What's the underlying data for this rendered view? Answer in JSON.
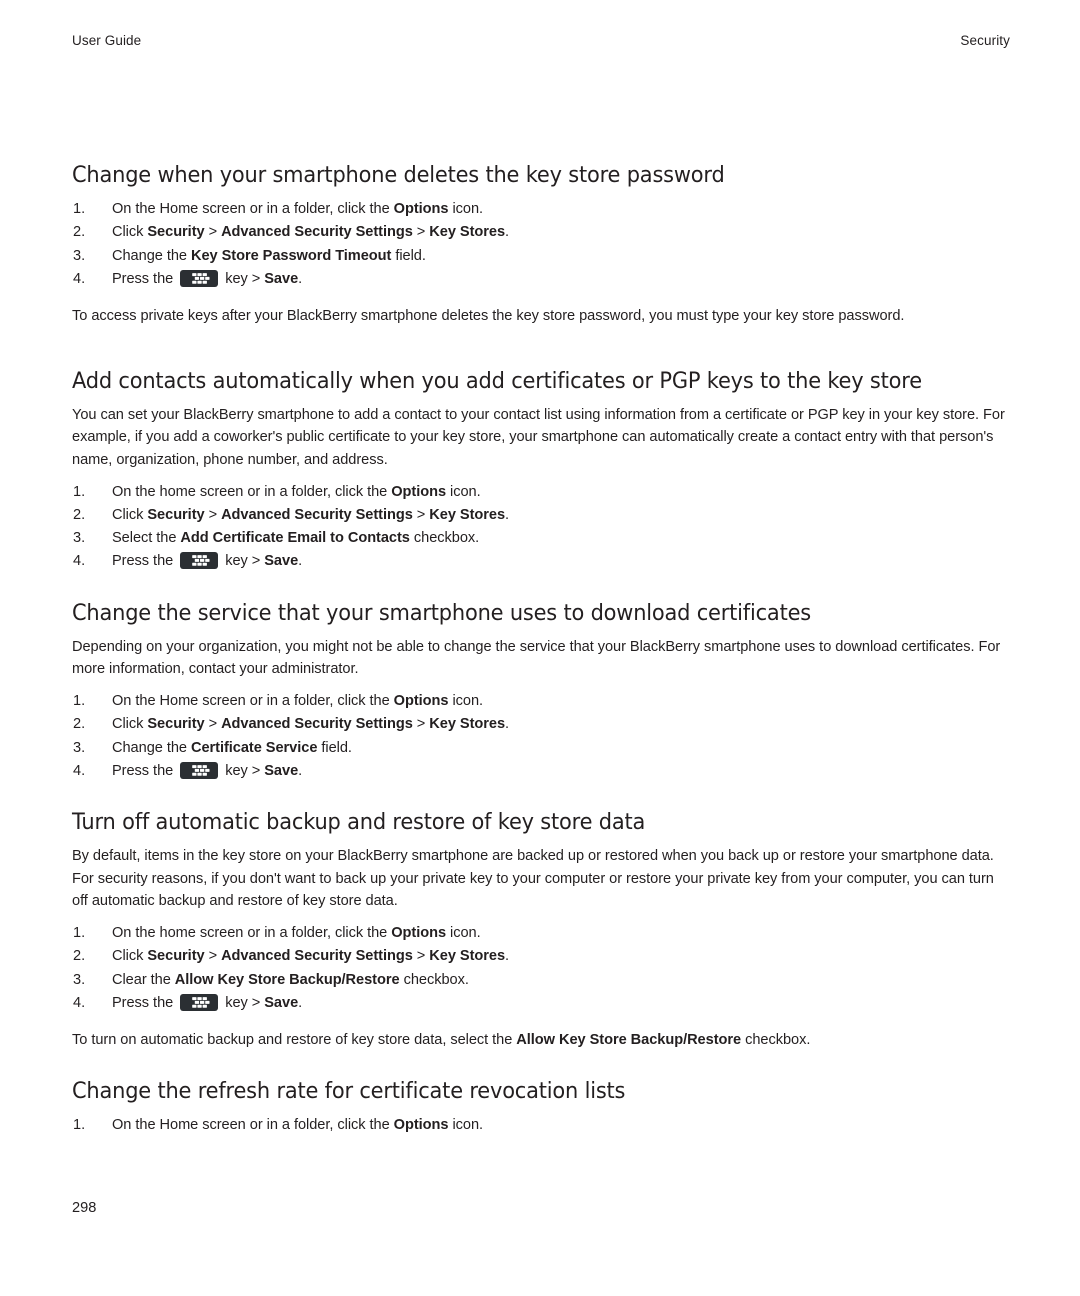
{
  "header": {
    "left": "User Guide",
    "right": "Security"
  },
  "footer": {
    "page_number": "298"
  },
  "icons": {
    "blackberry_menu_key": "blackberry-menu-key-icon"
  },
  "sections": [
    {
      "id": "change-when-deletes-key-store-password",
      "title": "Change when your smartphone deletes the key store password",
      "steps": [
        {
          "parts": [
            {
              "text": "On the Home screen or in a folder, click the ",
              "bold": false
            },
            {
              "text": "Options",
              "bold": true
            },
            {
              "text": " icon.",
              "bold": false
            }
          ]
        },
        {
          "parts": [
            {
              "text": "Click ",
              "bold": false
            },
            {
              "text": "Security",
              "bold": true
            },
            {
              "text": " > ",
              "bold": false
            },
            {
              "text": "Advanced Security Settings",
              "bold": true
            },
            {
              "text": " > ",
              "bold": false
            },
            {
              "text": "Key Stores",
              "bold": true
            },
            {
              "text": ".",
              "bold": false
            }
          ]
        },
        {
          "parts": [
            {
              "text": "Change the ",
              "bold": false
            },
            {
              "text": "Key Store Password Timeout",
              "bold": true
            },
            {
              "text": " field.",
              "bold": false
            }
          ]
        },
        {
          "parts": [
            {
              "text": "Press the ",
              "bold": false
            },
            {
              "icon": "blackberry-menu-key-icon"
            },
            {
              "text": " key > ",
              "bold": false
            },
            {
              "text": "Save",
              "bold": true
            },
            {
              "text": ".",
              "bold": false
            }
          ]
        }
      ],
      "after_note": "To access private keys after your BlackBerry smartphone deletes the key store password, you must type your key store password."
    },
    {
      "id": "add-contacts-automatically",
      "title": "Add contacts automatically when you add certificates or PGP keys to the key store",
      "intro": "You can set your BlackBerry smartphone to add a contact to your contact list using information from a certificate or PGP key in your key store. For example, if you add a coworker's public certificate to your key store, your smartphone can automatically create a contact entry with that person's name, organization, phone number, and address.",
      "steps": [
        {
          "parts": [
            {
              "text": "On the home screen or in a folder, click the ",
              "bold": false
            },
            {
              "text": "Options",
              "bold": true
            },
            {
              "text": " icon.",
              "bold": false
            }
          ]
        },
        {
          "parts": [
            {
              "text": "Click ",
              "bold": false
            },
            {
              "text": "Security",
              "bold": true
            },
            {
              "text": " > ",
              "bold": false
            },
            {
              "text": "Advanced Security Settings",
              "bold": true
            },
            {
              "text": " > ",
              "bold": false
            },
            {
              "text": "Key Stores",
              "bold": true
            },
            {
              "text": ".",
              "bold": false
            }
          ]
        },
        {
          "parts": [
            {
              "text": "Select the ",
              "bold": false
            },
            {
              "text": "Add Certificate Email to Contacts",
              "bold": true
            },
            {
              "text": " checkbox.",
              "bold": false
            }
          ]
        },
        {
          "parts": [
            {
              "text": "Press the ",
              "bold": false
            },
            {
              "icon": "blackberry-menu-key-icon"
            },
            {
              "text": " key > ",
              "bold": false
            },
            {
              "text": "Save",
              "bold": true
            },
            {
              "text": ".",
              "bold": false
            }
          ]
        }
      ]
    },
    {
      "id": "change-service-download-certificates",
      "title": "Change the service that your smartphone uses to download certificates",
      "intro": "Depending on your organization, you might not be able to change the service that your BlackBerry smartphone uses to download certificates. For more information, contact your administrator.",
      "steps": [
        {
          "parts": [
            {
              "text": "On the Home screen or in a folder, click the ",
              "bold": false
            },
            {
              "text": "Options",
              "bold": true
            },
            {
              "text": " icon.",
              "bold": false
            }
          ]
        },
        {
          "parts": [
            {
              "text": "Click ",
              "bold": false
            },
            {
              "text": "Security",
              "bold": true
            },
            {
              "text": " > ",
              "bold": false
            },
            {
              "text": "Advanced Security Settings",
              "bold": true
            },
            {
              "text": " > ",
              "bold": false
            },
            {
              "text": "Key Stores",
              "bold": true
            },
            {
              "text": ".",
              "bold": false
            }
          ]
        },
        {
          "parts": [
            {
              "text": "Change the ",
              "bold": false
            },
            {
              "text": "Certificate Service",
              "bold": true
            },
            {
              "text": " field.",
              "bold": false
            }
          ]
        },
        {
          "parts": [
            {
              "text": "Press the ",
              "bold": false
            },
            {
              "icon": "blackberry-menu-key-icon"
            },
            {
              "text": " key > ",
              "bold": false
            },
            {
              "text": "Save",
              "bold": true
            },
            {
              "text": ".",
              "bold": false
            }
          ]
        }
      ]
    },
    {
      "id": "turn-off-automatic-backup-restore",
      "title": "Turn off automatic backup and restore of key store data",
      "intro": "By default, items in the key store on your BlackBerry smartphone are backed up or restored when you back up or restore your smartphone data. For security reasons, if you don't want to back up your private key to your computer or restore your private key from your computer, you can turn off automatic backup and restore of key store data.",
      "steps": [
        {
          "parts": [
            {
              "text": "On the home screen or in a folder, click the ",
              "bold": false
            },
            {
              "text": "Options",
              "bold": true
            },
            {
              "text": " icon.",
              "bold": false
            }
          ]
        },
        {
          "parts": [
            {
              "text": "Click ",
              "bold": false
            },
            {
              "text": "Security",
              "bold": true
            },
            {
              "text": " > ",
              "bold": false
            },
            {
              "text": "Advanced Security Settings",
              "bold": true
            },
            {
              "text": " > ",
              "bold": false
            },
            {
              "text": "Key Stores",
              "bold": true
            },
            {
              "text": ".",
              "bold": false
            }
          ]
        },
        {
          "parts": [
            {
              "text": "Clear the ",
              "bold": false
            },
            {
              "text": "Allow Key Store Backup/Restore",
              "bold": true
            },
            {
              "text": " checkbox.",
              "bold": false
            }
          ]
        },
        {
          "parts": [
            {
              "text": "Press the ",
              "bold": false
            },
            {
              "icon": "blackberry-menu-key-icon"
            },
            {
              "text": " key > ",
              "bold": false
            },
            {
              "text": "Save",
              "bold": true
            },
            {
              "text": ".",
              "bold": false
            }
          ]
        }
      ],
      "after_note_parts": [
        {
          "text": "To turn on automatic backup and restore of key store data, select the ",
          "bold": false
        },
        {
          "text": "Allow Key Store Backup/Restore",
          "bold": true
        },
        {
          "text": " checkbox.",
          "bold": false
        }
      ]
    },
    {
      "id": "change-refresh-rate-crl",
      "title": "Change the refresh rate for certificate revocation lists",
      "steps": [
        {
          "parts": [
            {
              "text": "On the Home screen or in a folder, click the ",
              "bold": false
            },
            {
              "text": "Options",
              "bold": true
            },
            {
              "text": " icon.",
              "bold": false
            }
          ]
        }
      ]
    }
  ]
}
